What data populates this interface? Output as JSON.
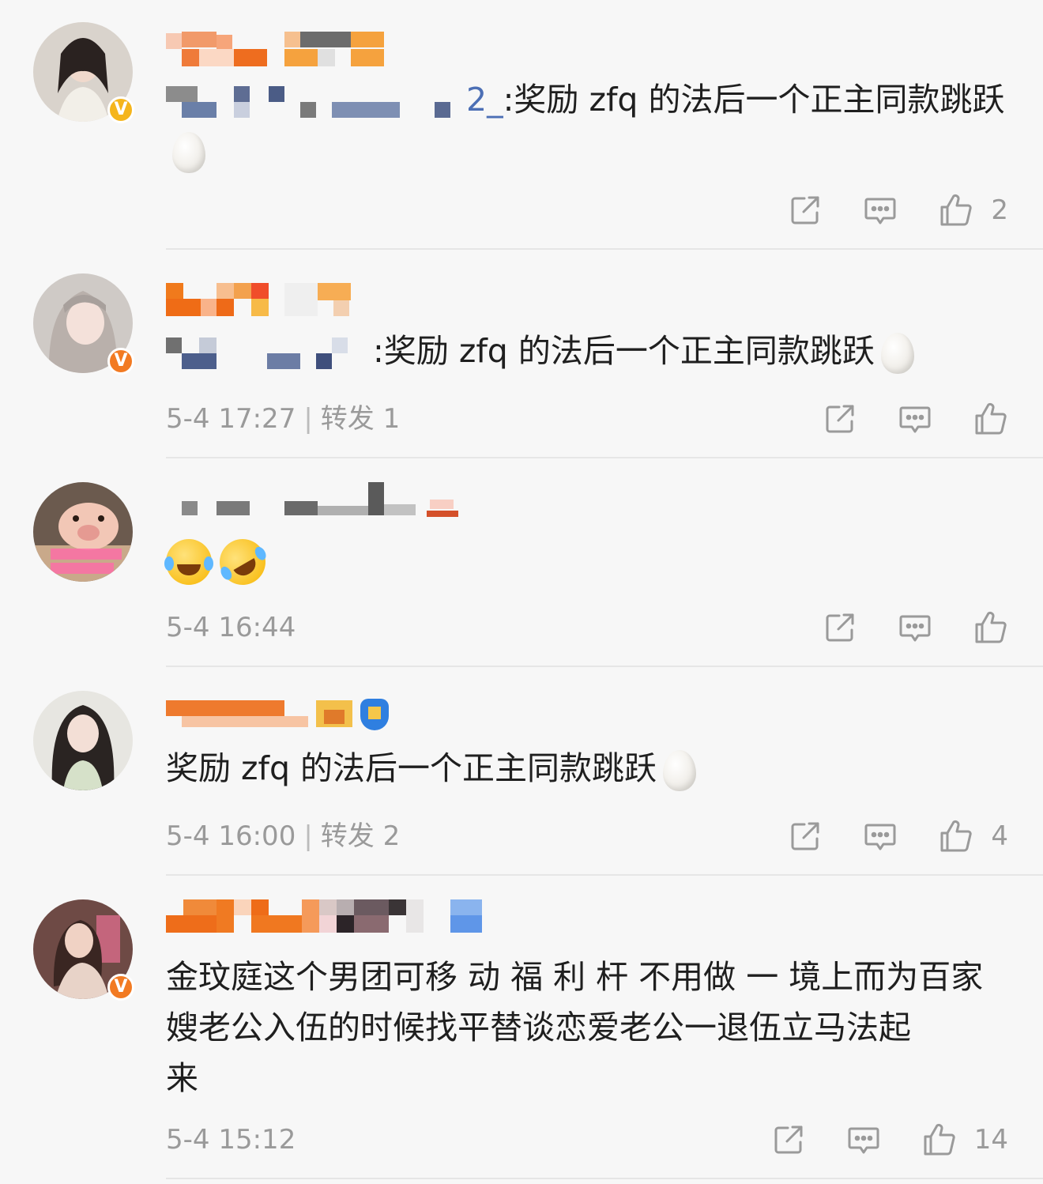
{
  "comments": [
    {
      "mention_text": "2_",
      "text": ":奖励 zfq 的法后一个正主同款跳跃",
      "egg_icon": "egg-emoji-icon",
      "timestamp": "",
      "forward": "",
      "likes": "2",
      "verified_badge": "V"
    },
    {
      "text": ":奖励 zfq 的法后一个正主同款跳跃",
      "egg_icon": "egg-emoji-icon",
      "timestamp": "5-4 17:27",
      "forward": "转发 1",
      "likes": "",
      "verified_badge": "V"
    },
    {
      "text": "",
      "emojis": [
        "laughing-tears-emoji",
        "rolling-laugh-emoji"
      ],
      "timestamp": "5-4 16:44",
      "forward": "",
      "likes": ""
    },
    {
      "text": "奖励 zfq 的法后一个正主同款跳跃",
      "egg_icon": "egg-emoji-icon",
      "timestamp": "5-4 16:00",
      "forward": "转发 2",
      "likes": "4"
    },
    {
      "text": "金玟庭这个男团可移 动 福 利 杆 不用做 一 境上而为百家",
      "text_line2": "嫂老公入伍的时候找平替谈恋爱老公一退伍立马法起",
      "text_line3": "来",
      "timestamp": "5-4 15:12",
      "forward": "",
      "likes": "14",
      "verified_badge": "V"
    }
  ],
  "separator": "|",
  "colors": {
    "background": "#f7f7f7",
    "meta_gray": "#9a9a9a",
    "mention_blue": "#4c6fb5",
    "badge_gold": "#f5b51c",
    "badge_orange": "#f27a22"
  },
  "icons": [
    "share-icon",
    "comment-icon",
    "like-icon"
  ]
}
